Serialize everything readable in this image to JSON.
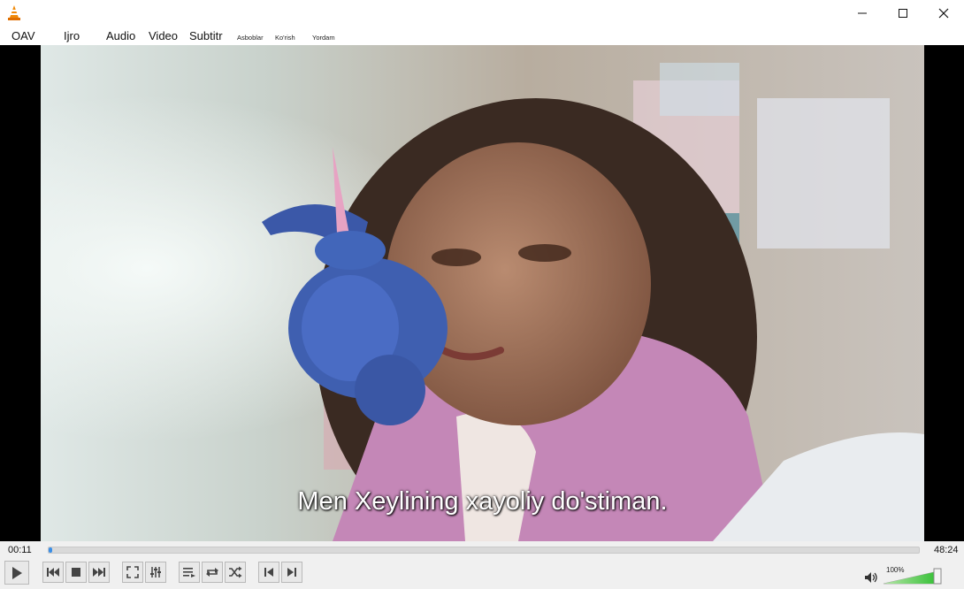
{
  "window": {
    "icon": "vlc-cone-icon",
    "controls": [
      "minimize-icon",
      "maximize-icon",
      "close-icon"
    ]
  },
  "menu": {
    "items": [
      "OAV",
      "Ijro",
      "Audio",
      "Video",
      "Subtitr",
      "Asboblar",
      "Ko'rish",
      "Yordam"
    ]
  },
  "video": {
    "subtitle": "Men Xeylining xayoliy do'stiman."
  },
  "timeline": {
    "elapsed": "00:11",
    "total": "48:24",
    "progress": 0.004
  },
  "volume": {
    "label": "100%",
    "level": 1.0
  },
  "colors": {
    "accent": "#3a8ee6",
    "volume_green": "#3cc23c",
    "vlc_orange": "#f08a0a"
  },
  "controls": {
    "buttons": [
      "play-icon",
      "previous-icon",
      "stop-icon",
      "next-icon",
      "fullscreen-icon",
      "extended-settings-icon",
      "playlist-icon",
      "loop-icon",
      "shuffle-icon",
      "frame-back-icon",
      "frame-forward-icon",
      "speaker-icon"
    ]
  }
}
